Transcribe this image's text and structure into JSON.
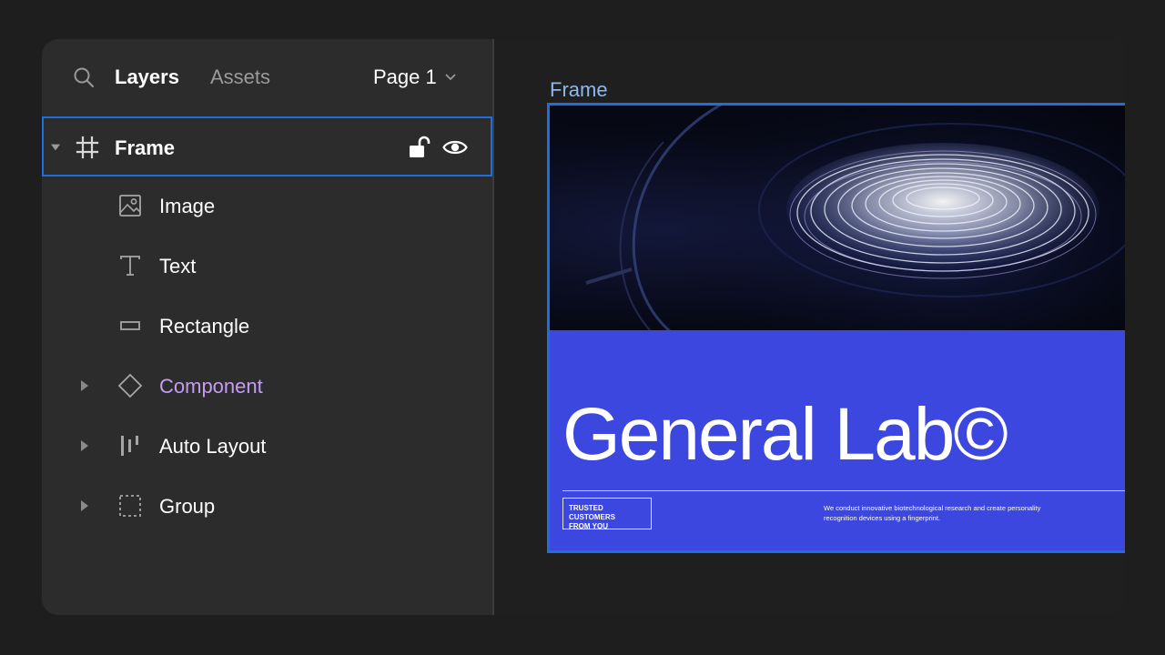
{
  "panel": {
    "tabs": {
      "layers": "Layers",
      "assets": "Assets"
    },
    "page_selector": {
      "value": "Page 1"
    },
    "layers": [
      {
        "label": "Frame",
        "icon": "hash-icon",
        "expanded": true,
        "selected": true
      },
      {
        "label": "Image",
        "icon": "image-icon"
      },
      {
        "label": "Text",
        "icon": "text-icon"
      },
      {
        "label": "Rectangle",
        "icon": "rectangle-icon"
      },
      {
        "label": "Component",
        "icon": "component-icon",
        "collapsed": true
      },
      {
        "label": "Auto Layout",
        "icon": "auto-layout-icon",
        "collapsed": true
      },
      {
        "label": "Group",
        "icon": "group-icon",
        "collapsed": true
      }
    ]
  },
  "canvas": {
    "frame_label": "Frame",
    "brand_title": "General Lab©",
    "badge": {
      "line1": "TRUSTED CUSTOMERS",
      "line2": "FROM YOU"
    },
    "description": "We conduct innovative biotechnological research and create personality recognition devices using a fingerprint."
  },
  "colors": {
    "selection": "#1e6fd9",
    "component": "#c59cf5",
    "brand_blue": "#3b47df",
    "frame_label": "#8cb8ef"
  }
}
